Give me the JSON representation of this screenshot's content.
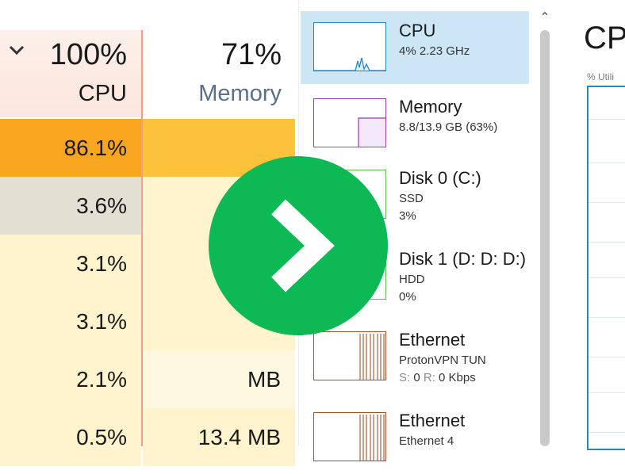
{
  "processes": {
    "cpu_header": {
      "percent": "100%",
      "label": "CPU"
    },
    "memory_header": {
      "percent": "71%",
      "label": "Memory"
    },
    "colors": {
      "cpu_header_bg": "#fbe6dc",
      "cpu_accent": "#f2a083",
      "memory_label": "#5b6f86"
    },
    "rows": [
      {
        "cpu": "86.1%",
        "memory": "",
        "cpu_bg": "#f8a620",
        "mem_bg": "#fbc23a"
      },
      {
        "cpu": "3.6%",
        "memory": "",
        "cpu_bg": "#e3dfd3",
        "mem_bg": "#fff4cd"
      },
      {
        "cpu": "3.1%",
        "memory": "",
        "cpu_bg": "#fff4cd",
        "mem_bg": "#fff4cd"
      },
      {
        "cpu": "3.1%",
        "memory": "",
        "cpu_bg": "#fff4cd",
        "mem_bg": "#fff4cd"
      },
      {
        "cpu": "2.1%",
        "memory": "MB",
        "cpu_bg": "#fff4cd",
        "mem_bg": "#fff8e1"
      },
      {
        "cpu": "0.5%",
        "memory": "13.4 MB",
        "cpu_bg": "#fff4cd",
        "mem_bg": "#fff4cd"
      }
    ]
  },
  "sidebar": {
    "tiles": [
      {
        "title": "CPU",
        "line1": "4% 2.23 GHz",
        "line2": "",
        "selected": true,
        "color": "#1f88c8",
        "graph": "cpu"
      },
      {
        "title": "Memory",
        "line1": "8.8/13.9 GB (63%)",
        "line2": "",
        "selected": false,
        "color": "#9b3fbf",
        "graph": "memory"
      },
      {
        "title": "Disk 0 (C:)",
        "line1": "SSD",
        "line2": "3%",
        "selected": false,
        "color": "#5cbb4a",
        "graph": "disk"
      },
      {
        "title": "Disk 1 (D: D: D:)",
        "line1": "HDD",
        "line2": "0%",
        "selected": false,
        "color": "#5cbb4a",
        "graph": "disk"
      },
      {
        "title": "Ethernet",
        "line1": "ProtonVPN TUN",
        "line2_label_s": "S:",
        "line2_s": "0",
        "line2_label_r": "R:",
        "line2_r": "0 Kbps",
        "selected": false,
        "color": "#a0522d",
        "graph": "ethernet"
      },
      {
        "title": "Ethernet",
        "line1": "Ethernet 4",
        "line2": "",
        "selected": false,
        "color": "#a0522d",
        "graph": "ethernet"
      }
    ]
  },
  "detail": {
    "title": "CPU",
    "graph_label": "% Utili",
    "graph_color": "#1f88c8"
  },
  "overlay": {
    "icon": "chevron-right-icon",
    "color": "#0cb955"
  }
}
